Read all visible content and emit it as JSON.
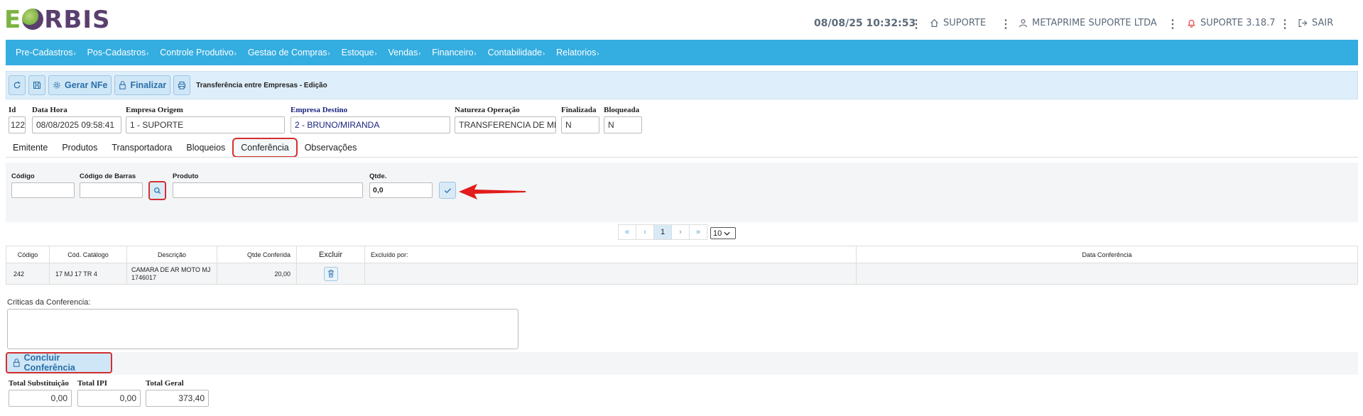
{
  "logo": {
    "e": "E",
    "rest": "RBIS"
  },
  "header": {
    "datetime": "08/08/25 10:32:53",
    "home_label": "SUPORTE",
    "user_label": "METAPRIME SUPORTE LTDA",
    "version_label": "SUPORTE 3.18.7",
    "logout_label": "SAIR"
  },
  "menu": [
    "Pre-Cadastros",
    "Pos-Cadastros",
    "Controle Produtivo",
    "Gestao de Compras",
    "Estoque",
    "Vendas",
    "Financeiro",
    "Contabilidade",
    "Relatorios"
  ],
  "toolbar": {
    "gerar_nfe": "Gerar NFe",
    "finalizar": "Finalizar",
    "title": "Transferência entre Empresas - Edição"
  },
  "form": {
    "id_label": "Id",
    "id_value": "122",
    "datahora_label": "Data Hora",
    "datahora_value": "08/08/2025 09:58:41",
    "origem_label": "Empresa Origem",
    "origem_value": "1 - SUPORTE",
    "destino_label": "Empresa Destino",
    "destino_value": "2 - BRUNO/MIRANDA",
    "natureza_label": "Natureza Operação",
    "natureza_value": "TRANSFERENCIA DE MERCADORIA",
    "finalizada_label": "Finalizada",
    "finalizada_value": "N",
    "bloqueada_label": "Bloqueada",
    "bloqueada_value": "N"
  },
  "tabs": [
    "Emitente",
    "Produtos",
    "Transportadora",
    "Bloqueios",
    "Conferência",
    "Observações"
  ],
  "conferencia": {
    "codigo_label": "Código",
    "barras_label": "Código de Barras",
    "produto_label": "Produto",
    "qtde_label": "Qtde.",
    "qtde_value": "0,0"
  },
  "pager": {
    "first": "«",
    "prev": "‹",
    "page": "1",
    "next": "›",
    "last": "»",
    "size": "10"
  },
  "grid": {
    "headers": [
      "Código",
      "Cód. Catálogo",
      "Descrição",
      "Qtde Conferida",
      "Excluir",
      "Excluído por:",
      "Data Conferência"
    ],
    "rows": [
      {
        "codigo": "242",
        "catalogo": "17 MJ 17 TR 4",
        "descricao": "CAMARA DE AR MOTO MJ 1746017",
        "qtde": "20,00",
        "excluido_por": "",
        "data": ""
      }
    ]
  },
  "criticas_label": "Criticas da Conferencia:",
  "concluir_label": "Concluir Conferência",
  "totals": {
    "subst_label": "Total Substituição",
    "subst_value": "0,00",
    "ipi_label": "Total IPI",
    "ipi_value": "0,00",
    "geral_label": "Total Geral",
    "geral_value": "373,40"
  },
  "colors": {
    "menubar": "#34ade0",
    "toolbar": "#deeefa",
    "highlight": "#d32f2f",
    "logo_green": "#7cb342",
    "logo_purple": "#5a3f6e"
  }
}
